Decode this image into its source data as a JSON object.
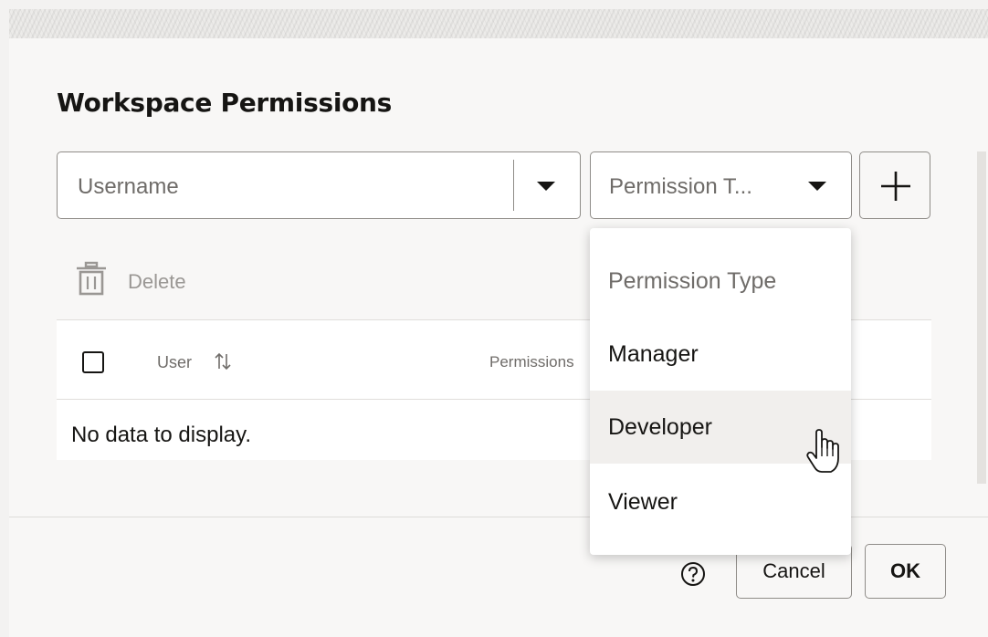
{
  "dialog": {
    "title": "Workspace Permissions"
  },
  "username_combo": {
    "placeholder": "Username"
  },
  "permission_combo": {
    "placeholder": "Permission T..."
  },
  "toolbar": {
    "delete_label": "Delete"
  },
  "table": {
    "columns": [
      "User",
      "Permissions"
    ],
    "empty_text": "No data to display."
  },
  "dropdown": {
    "placeholder": "Permission Type",
    "options": [
      "Manager",
      "Developer",
      "Viewer"
    ],
    "hovered": "Developer"
  },
  "footer": {
    "cancel_label": "Cancel",
    "ok_label": "OK"
  },
  "icons": {
    "add": "plus-icon",
    "delete": "trash-icon",
    "sort": "sort-icon",
    "help": "help-circle-icon",
    "cursor": "hand-pointer-icon",
    "caret": "caret-down-icon"
  }
}
